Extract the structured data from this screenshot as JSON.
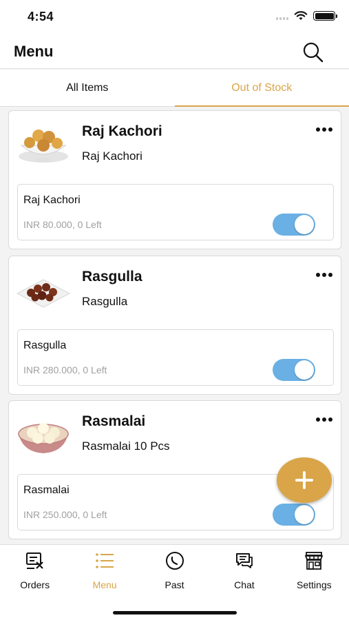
{
  "status": {
    "time": "4:54"
  },
  "header": {
    "title": "Menu"
  },
  "tabs": [
    {
      "label": "All Items",
      "active": false
    },
    {
      "label": "Out of Stock",
      "active": true
    }
  ],
  "items": [
    {
      "title": "Raj Kachori",
      "subtitle": "Raj Kachori",
      "variant_name": "Raj Kachori",
      "variant_info": "INR 80.000, 0 Left",
      "toggle_on": true
    },
    {
      "title": "Rasgulla",
      "subtitle": "Rasgulla",
      "variant_name": "Rasgulla",
      "variant_info": "INR 280.000, 0 Left",
      "toggle_on": true
    },
    {
      "title": "Rasmalai",
      "subtitle": "Rasmalai 10 Pcs",
      "variant_name": "Rasmalai",
      "variant_info": "INR 250.000, 0 Left",
      "toggle_on": true
    }
  ],
  "nav": [
    {
      "label": "Orders",
      "icon": "orders-icon",
      "active": false
    },
    {
      "label": "Menu",
      "icon": "menu-list-icon",
      "active": true
    },
    {
      "label": "Past",
      "icon": "past-clock-icon",
      "active": false
    },
    {
      "label": "Chat",
      "icon": "chat-icon",
      "active": false
    },
    {
      "label": "Settings",
      "icon": "store-icon",
      "active": false
    }
  ],
  "colors": {
    "accent": "#d9a548",
    "toggle": "#6ab0e4"
  }
}
